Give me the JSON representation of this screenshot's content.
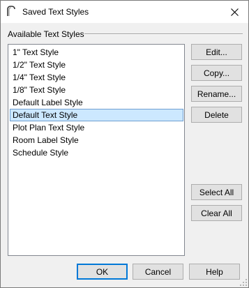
{
  "window": {
    "title": "Saved Text Styles",
    "close_glyph": "✕"
  },
  "group": {
    "label": "Available Text Styles"
  },
  "styles": [
    {
      "label": "1\" Text Style"
    },
    {
      "label": "1/2\" Text Style"
    },
    {
      "label": "1/4\" Text Style"
    },
    {
      "label": "1/8\" Text Style"
    },
    {
      "label": "Default Label Style"
    },
    {
      "label": "Default Text Style",
      "selected": true
    },
    {
      "label": "Plot Plan Text Style"
    },
    {
      "label": "Room Label Style"
    },
    {
      "label": "Schedule Style"
    }
  ],
  "side_buttons": {
    "edit": "Edit...",
    "copy": "Copy...",
    "rename": "Rename...",
    "delete": "Delete",
    "select_all": "Select All",
    "clear_all": "Clear All"
  },
  "footer": {
    "ok": "OK",
    "cancel": "Cancel",
    "help": "Help"
  },
  "colors": {
    "selection": "#cce8ff",
    "selection_border": "#6e9fd1",
    "default_button_border": "#0078d7"
  }
}
